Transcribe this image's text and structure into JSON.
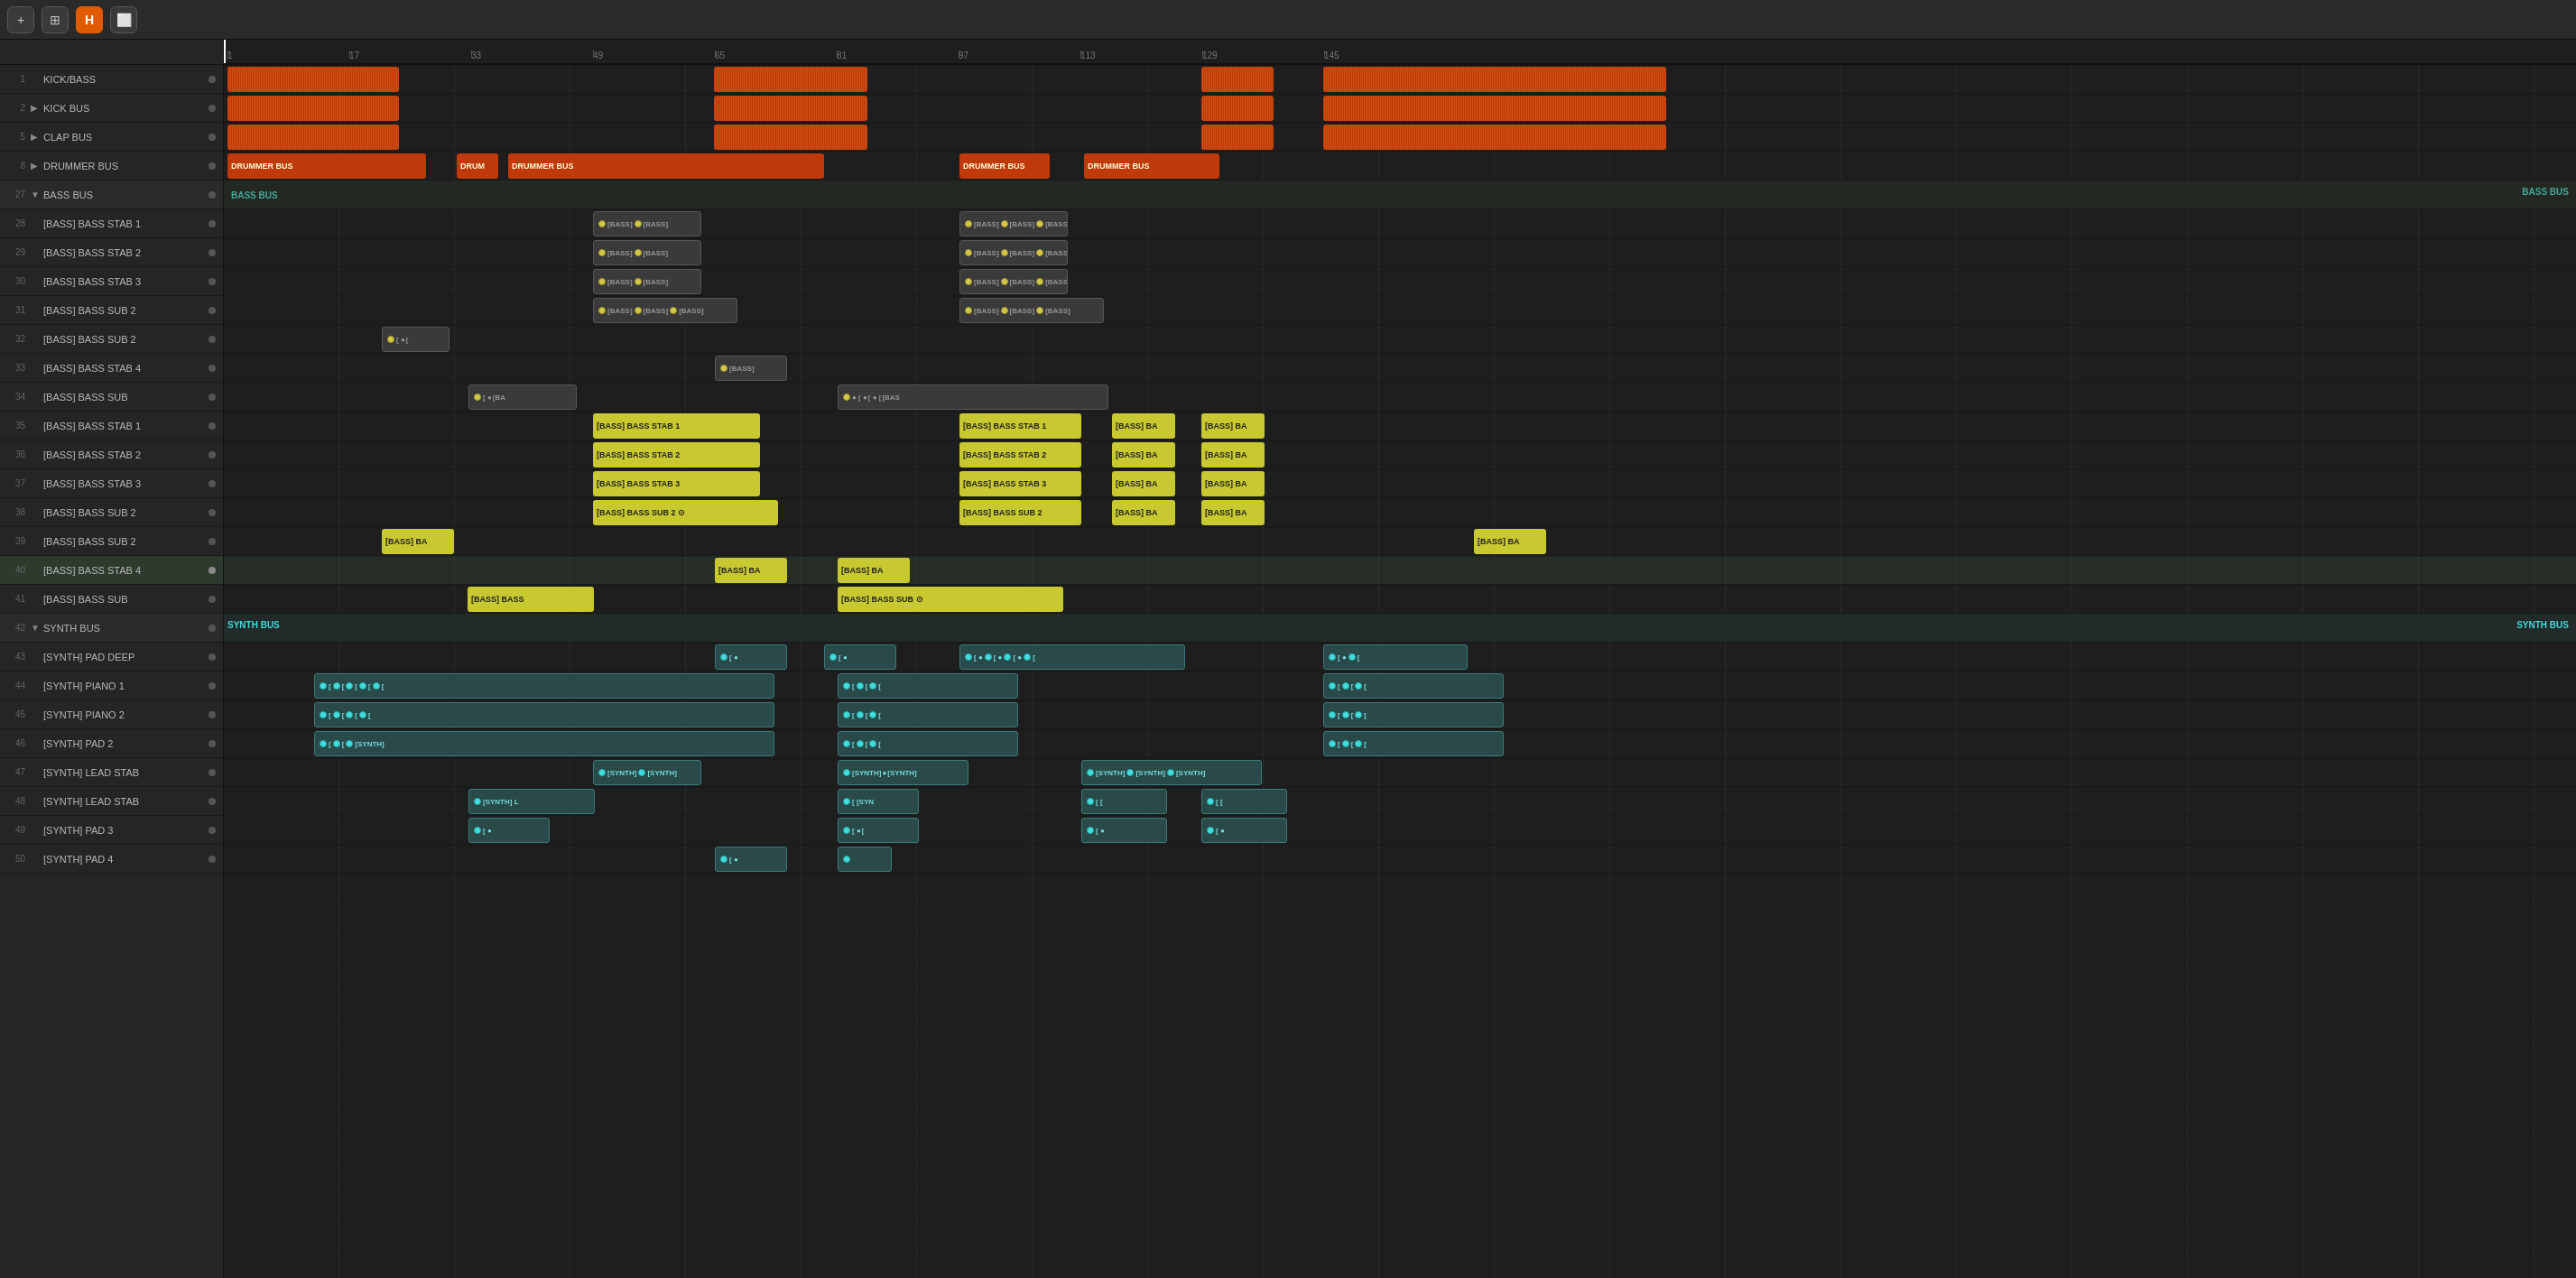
{
  "toolbar": {
    "add_label": "+",
    "history_label": "H",
    "icons": [
      "add",
      "history",
      "header",
      "export"
    ]
  },
  "ruler": {
    "marks": [
      1,
      17,
      33,
      49,
      65,
      81,
      97,
      113,
      129,
      145
    ],
    "playhead_position": 0
  },
  "tracks": [
    {
      "num": "1",
      "name": "KICK/BASS",
      "indent": 0,
      "expand": "",
      "type": "audio"
    },
    {
      "num": "2",
      "name": "KICK BUS",
      "indent": 0,
      "expand": ">",
      "type": "bus"
    },
    {
      "num": "5",
      "name": "CLAP BUS",
      "indent": 0,
      "expand": ">",
      "type": "bus"
    },
    {
      "num": "8",
      "name": "DRUMMER BUS",
      "indent": 0,
      "expand": ">",
      "type": "bus"
    },
    {
      "num": "27",
      "name": "BASS BUS",
      "indent": 0,
      "expand": "v",
      "type": "bus"
    },
    {
      "num": "28",
      "name": "[BASS] BASS STAB 1",
      "indent": 1,
      "expand": "",
      "type": "midi"
    },
    {
      "num": "29",
      "name": "[BASS] BASS STAB 2",
      "indent": 1,
      "expand": "",
      "type": "midi"
    },
    {
      "num": "30",
      "name": "[BASS] BASS STAB 3",
      "indent": 1,
      "expand": "",
      "type": "midi"
    },
    {
      "num": "31",
      "name": "[BASS] BASS SUB 2",
      "indent": 1,
      "expand": "",
      "type": "midi"
    },
    {
      "num": "32",
      "name": "[BASS] BASS SUB 2",
      "indent": 1,
      "expand": "",
      "type": "midi"
    },
    {
      "num": "33",
      "name": "[BASS] BASS STAB 4",
      "indent": 1,
      "expand": "",
      "type": "midi"
    },
    {
      "num": "34",
      "name": "[BASS] BASS SUB",
      "indent": 1,
      "expand": "",
      "type": "midi"
    },
    {
      "num": "35",
      "name": "[BASS] BASS STAB 1",
      "indent": 1,
      "expand": "",
      "type": "midi"
    },
    {
      "num": "36",
      "name": "[BASS] BASS STAB 2",
      "indent": 1,
      "expand": "",
      "type": "midi"
    },
    {
      "num": "37",
      "name": "[BASS] BASS STAB 3",
      "indent": 1,
      "expand": "",
      "type": "midi"
    },
    {
      "num": "38",
      "name": "[BASS] BASS SUB 2",
      "indent": 1,
      "expand": "",
      "type": "midi"
    },
    {
      "num": "39",
      "name": "[BASS] BASS SUB 2",
      "indent": 1,
      "expand": "",
      "type": "midi"
    },
    {
      "num": "40",
      "name": "[BASS] BASS STAB 4",
      "indent": 1,
      "expand": "",
      "type": "midi",
      "selected": true
    },
    {
      "num": "41",
      "name": "[BASS] BASS SUB",
      "indent": 1,
      "expand": "",
      "type": "midi"
    },
    {
      "num": "42",
      "name": "SYNTH BUS",
      "indent": 0,
      "expand": "v",
      "type": "bus"
    },
    {
      "num": "43",
      "name": "[SYNTH] PAD DEEP",
      "indent": 1,
      "expand": "",
      "type": "midi"
    },
    {
      "num": "44",
      "name": "[SYNTH] PIANO 1",
      "indent": 1,
      "expand": "",
      "type": "midi"
    },
    {
      "num": "45",
      "name": "[SYNTH] PIANO 2",
      "indent": 1,
      "expand": "",
      "type": "midi"
    },
    {
      "num": "46",
      "name": "[SYNTH] PAD 2",
      "indent": 1,
      "expand": "",
      "type": "midi"
    },
    {
      "num": "47",
      "name": "[SYNTH] LEAD STAB",
      "indent": 1,
      "expand": "",
      "type": "midi"
    },
    {
      "num": "48",
      "name": "[SYNTH] LEAD STAB",
      "indent": 1,
      "expand": "",
      "type": "midi"
    },
    {
      "num": "49",
      "name": "[SYNTH] PAD 3",
      "indent": 1,
      "expand": "",
      "type": "midi"
    },
    {
      "num": "50",
      "name": "[SYNTH] PAD 4",
      "indent": 1,
      "expand": "",
      "type": "midi"
    }
  ],
  "clips": {
    "note": "Clips are positioned absolutely within lane rows"
  }
}
